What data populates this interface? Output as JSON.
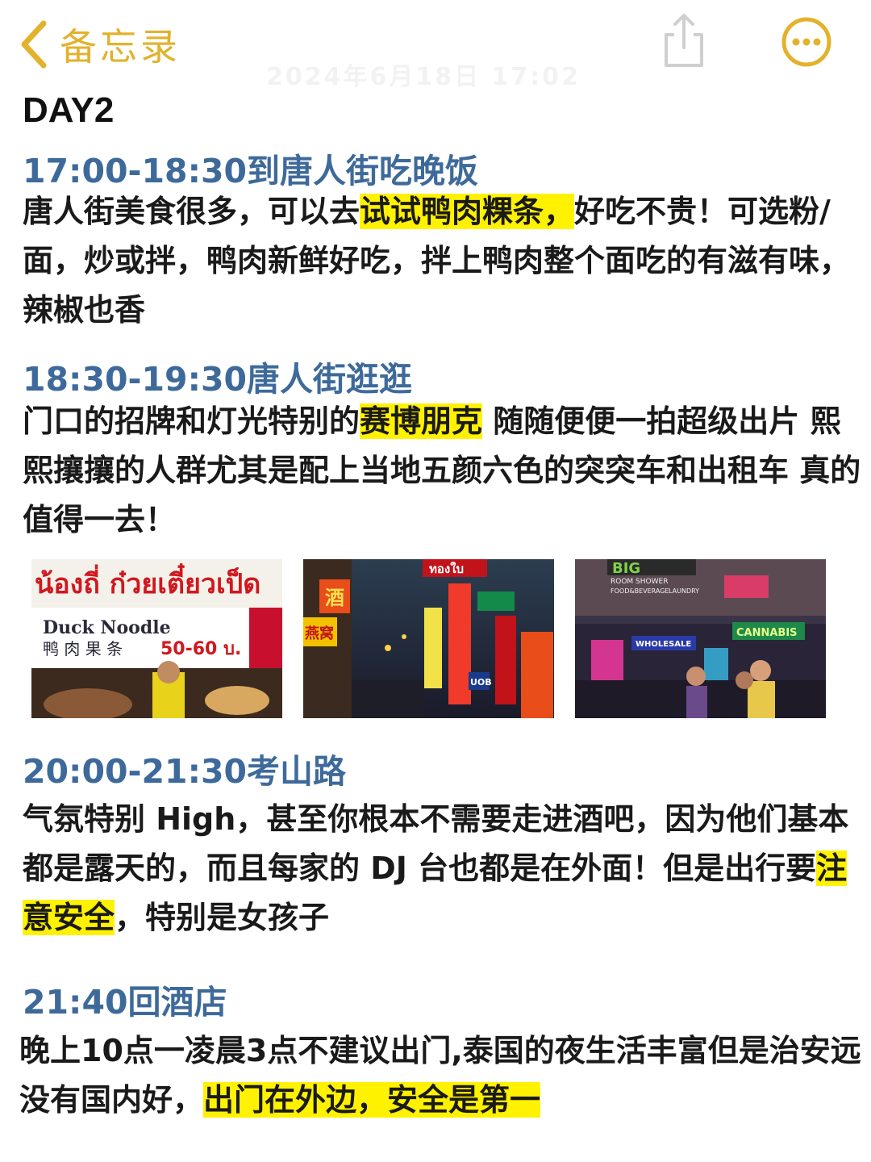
{
  "nav": {
    "back_label": "备忘录",
    "ghost_date": "2024年6月18日 17:02",
    "accent_color": "#E2B22C",
    "share_icon": "share-icon",
    "more_icon": "more-icon"
  },
  "note": {
    "day_title": "DAY2",
    "sections": [
      {
        "heading": "17:00-18:30到唐人街吃晚饭",
        "body_1": "唐人街美食很多，可以去",
        "highlight_1": "试试鸭肉粿条，",
        "body_2": "好吃不贵！可选粉/面，炒或拌，鸭肉新鲜好吃，拌上鸭肉整个面吃的有滋有味，辣椒也香"
      },
      {
        "heading": "18:30-19:30唐人街逛逛",
        "body_1": "门口的招牌和灯光特别的",
        "highlight_1": "赛博朋克",
        "body_2": " 随随便便一拍超级出片 熙熙攘攘的人群尤其是配上当地五颜六色的突突车和出租车 真的值得一去！"
      },
      {
        "heading": "20:00-21:30考山路",
        "body_1": "气氛特别 High，甚至你根本不需要走进酒吧，因为他们基本都是露天的，而且每家的 DJ 台也都是在外面！但是出行要",
        "highlight_1": "注意安全",
        "body_2": "，特别是女孩子"
      },
      {
        "heading": "21:40回酒店",
        "body_1": "晚上10点一凌晨3点不建议出门,泰国的夜生活丰富但是治安远没有国内好，",
        "highlight_1": "出门在外边，安全是第一",
        "body_2": ""
      }
    ],
    "highlight_color": "#FFF200",
    "heading_color": "#3E6A9B"
  },
  "photos": [
    {
      "sign_thai": "น้องถี่ ก๋วยเตี๋ยวเป็ด",
      "sign_en": "Duck Noodle",
      "sign_cn": "鸭 肉 果 条",
      "price": "50-60 บ."
    },
    {
      "sign_top": "ทองใบ",
      "sign_left": "酒",
      "sign_mid": "燕窝",
      "sign_bank": "UOB"
    },
    {
      "sign_big": "BIG",
      "sign_room": "ROOM SHOWER",
      "sign_food": "FOOD&BEVERAGE",
      "sign_laundry": "LAUNDRY",
      "sign_cannabis": "CANNABIS",
      "sign_wholesale": "WHOLESALE"
    }
  ]
}
